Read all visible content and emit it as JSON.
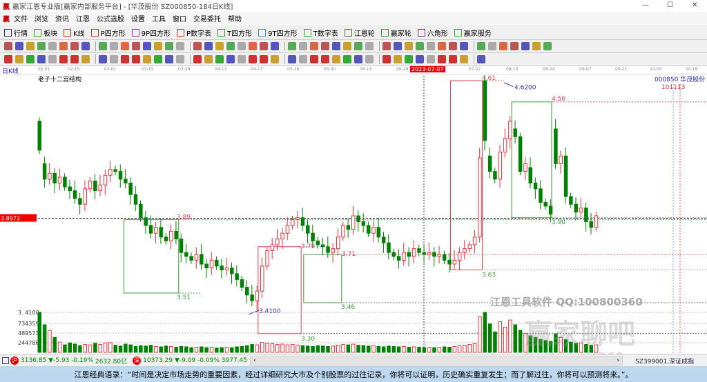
{
  "window": {
    "title": "赢家江恩专业版[赢家内部服务平台] - [华茂股份  SZ000850-184日K线]",
    "controls": [
      "minimize",
      "restore",
      "close"
    ]
  },
  "menu": [
    "文件",
    "浏览",
    "资讯",
    "江恩",
    "公式选股",
    "设置",
    "工具",
    "窗口",
    "交易委托",
    "帮助"
  ],
  "toolbar": [
    "行情",
    "板块",
    "K线",
    "P四方形",
    "9P四方形",
    "P数字表",
    "T四方形",
    "9T四方形",
    "T数字表",
    "江恩轮",
    "赢家轮",
    "六角形",
    "赢家服务"
  ],
  "toolbar_icons": [
    "grid-icon",
    "blocks-icon",
    "kline-icon",
    "ps-icon",
    "p9-icon",
    "pn-icon",
    "ts-icon",
    "t9-icon",
    "tn-icon",
    "gann-wheel-icon",
    "winner-wheel-icon",
    "hexagon-icon",
    "dollar-icon"
  ],
  "chart": {
    "period_label": "日K线",
    "study_label": "老子十二宫结构",
    "stock_label": "000850  华茂股份",
    "right_marker": "101113",
    "dates": [
      "02-01",
      "02-15",
      "03-01",
      "03-15",
      "03-29",
      "04-13",
      "04-27",
      "05-16",
      "05-30",
      "06-13",
      "06-28",
      "2023-07-07",
      "07-27",
      "08-10",
      "08-24",
      "09-07",
      "09-21",
      "10-05",
      "10-19"
    ],
    "cursor_date": "2023-07-07",
    "current_price": "3.8973",
    "high_label": "4.6200",
    "low_label": "3.4100",
    "levels": {
      "a": "3.89",
      "b": "3.51",
      "c": "3.75",
      "d": "3.30",
      "e": "3.71",
      "f": "3.46",
      "g": "4.61",
      "h": "3.63",
      "i": "4.50",
      "j": "3.90"
    },
    "volume_axis": [
      "3. 4100",
      "734359",
      "489573",
      "244786"
    ],
    "watermark": "江恩工具软件  QQ:100800360",
    "watermark2": "赢家聊吧",
    "watermark3": "liaoba.vict360.com",
    "colors": {
      "up": "#e0303a",
      "down": "#008000",
      "box_green": "#3a9a3a",
      "box_red": "#d84050",
      "annot": "#3030a0"
    },
    "candles": [
      [
        4.4,
        4.25
      ],
      [
        4.18,
        4.1
      ],
      [
        4.1,
        4.13
      ],
      [
        4.13,
        4.08
      ],
      [
        4.08,
        4.11
      ],
      [
        4.11,
        4.06
      ],
      [
        4.06,
        4.04
      ],
      [
        4.04,
        4.0
      ],
      [
        4.0,
        3.97
      ],
      [
        3.97,
        4.05
      ],
      [
        4.05,
        4.09
      ],
      [
        4.09,
        4.04
      ],
      [
        4.04,
        4.07
      ],
      [
        4.07,
        4.12
      ],
      [
        4.12,
        4.15
      ],
      [
        4.15,
        4.14
      ],
      [
        4.14,
        4.1
      ],
      [
        4.1,
        4.08
      ],
      [
        4.08,
        4.02
      ],
      [
        4.02,
        3.97
      ],
      [
        3.97,
        3.9
      ],
      [
        3.9,
        3.86
      ],
      [
        3.86,
        3.82
      ],
      [
        3.82,
        3.85
      ],
      [
        3.85,
        3.8
      ],
      [
        3.8,
        3.78
      ],
      [
        3.78,
        3.83
      ],
      [
        3.83,
        3.79
      ],
      [
        3.79,
        3.72
      ],
      [
        3.72,
        3.7
      ],
      [
        3.7,
        3.68
      ],
      [
        3.68,
        3.71
      ],
      [
        3.71,
        3.66
      ],
      [
        3.66,
        3.64
      ],
      [
        3.64,
        3.68
      ],
      [
        3.68,
        3.65
      ],
      [
        3.65,
        3.63
      ],
      [
        3.63,
        3.64
      ],
      [
        3.64,
        3.61
      ],
      [
        3.61,
        3.58
      ],
      [
        3.58,
        3.54
      ],
      [
        3.54,
        3.5
      ],
      [
        3.5,
        3.47
      ],
      [
        3.47,
        3.52
      ],
      [
        3.52,
        3.65
      ],
      [
        3.65,
        3.73
      ],
      [
        3.73,
        3.76
      ],
      [
        3.76,
        3.79
      ],
      [
        3.79,
        3.82
      ],
      [
        3.82,
        3.86
      ],
      [
        3.86,
        3.89
      ],
      [
        3.89,
        3.9
      ],
      [
        3.9,
        3.86
      ],
      [
        3.86,
        3.82
      ],
      [
        3.82,
        3.78
      ],
      [
        3.78,
        3.76
      ],
      [
        3.76,
        3.75
      ],
      [
        3.75,
        3.72
      ],
      [
        3.72,
        3.74
      ],
      [
        3.74,
        3.8
      ],
      [
        3.8,
        3.86
      ],
      [
        3.86,
        3.84
      ],
      [
        3.84,
        3.91
      ],
      [
        3.91,
        3.88
      ],
      [
        3.88,
        3.86
      ],
      [
        3.86,
        3.82
      ],
      [
        3.82,
        3.85
      ],
      [
        3.85,
        3.8
      ],
      [
        3.8,
        3.77
      ],
      [
        3.77,
        3.72
      ],
      [
        3.72,
        3.7
      ],
      [
        3.7,
        3.68
      ],
      [
        3.68,
        3.72
      ],
      [
        3.72,
        3.7
      ],
      [
        3.7,
        3.74
      ],
      [
        3.74,
        3.72
      ],
      [
        3.72,
        3.71
      ],
      [
        3.71,
        3.72
      ],
      [
        3.72,
        3.7
      ],
      [
        3.7,
        3.71
      ],
      [
        3.71,
        3.68
      ],
      [
        3.68,
        3.66
      ],
      [
        3.66,
        3.68
      ],
      [
        3.68,
        3.72
      ],
      [
        3.72,
        3.74
      ],
      [
        3.74,
        3.76
      ],
      [
        3.76,
        3.8
      ],
      [
        3.8,
        4.21
      ],
      [
        4.61,
        4.3
      ],
      [
        4.22,
        4.14
      ],
      [
        4.14,
        4.1
      ],
      [
        4.1,
        4.24
      ],
      [
        4.24,
        4.31
      ],
      [
        4.31,
        4.4
      ],
      [
        4.36,
        4.32
      ],
      [
        4.32,
        4.14
      ],
      [
        4.14,
        4.18
      ],
      [
        4.16,
        4.08
      ],
      [
        4.08,
        4.05
      ],
      [
        4.05,
        3.98
      ],
      [
        3.98,
        3.96
      ],
      [
        3.96,
        3.92
      ],
      [
        4.36,
        4.18
      ],
      [
        4.18,
        4.22
      ],
      [
        4.22,
        4.01
      ],
      [
        4.01,
        3.97
      ],
      [
        3.97,
        3.93
      ],
      [
        3.93,
        3.95
      ],
      [
        3.95,
        3.88
      ],
      [
        3.88,
        3.85
      ],
      [
        3.85,
        3.91
      ]
    ],
    "volumes": [
      1150000,
      700000,
      560000,
      380000,
      260000,
      190000,
      240000,
      210000,
      170000,
      200000,
      190000,
      230000,
      200000,
      240000,
      250000,
      180000,
      160000,
      210000,
      190000,
      150000,
      170000,
      160000,
      180000,
      150000,
      140000,
      160000,
      150000,
      130000,
      150000,
      140000,
      120000,
      130000,
      140000,
      120000,
      130000,
      110000,
      120000,
      130000,
      120000,
      140000,
      150000,
      170000,
      200000,
      190000,
      250000,
      230000,
      220000,
      200000,
      210000,
      190000,
      200000,
      180000,
      170000,
      160000,
      150000,
      170000,
      160000,
      150000,
      160000,
      180000,
      200000,
      190000,
      210000,
      180000,
      170000,
      160000,
      170000,
      150000,
      140000,
      160000,
      150000,
      140000,
      150000,
      130000,
      140000,
      130000,
      120000,
      130000,
      120000,
      130000,
      140000,
      130000,
      150000,
      170000,
      180000,
      200000,
      220000,
      900000,
      1080000,
      720000,
      520000,
      780000,
      640000,
      820000,
      700000,
      560000,
      480000,
      420000,
      380000,
      330000,
      300000,
      280000,
      470000,
      380000,
      320000,
      260000,
      230000,
      240000,
      200000,
      180000,
      190000
    ]
  },
  "status": {
    "sh_index": "3136.85",
    "sh_change": "▼-5.93",
    "sh_pct": "-0.19%",
    "sh_amount": "2632.80亿",
    "sz_index": "10373.29",
    "sz_change": "▼-9.09",
    "sz_pct": "-0.09%",
    "sz_amount": "3977.45",
    "index_code": "SZ399001,深证成指"
  },
  "quote": "江恩经典语录：“时间是决定市场走势的重要因素，经过详细研究大市及个别股票的过往记录，你将可以证明，历史确实重复发生；而了解过往，你将可以预测将来。”。"
}
